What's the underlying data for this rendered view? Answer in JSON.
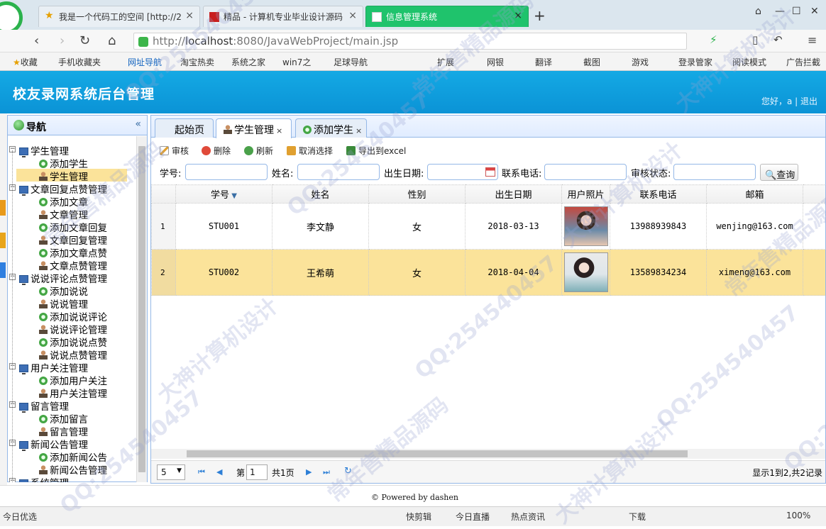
{
  "browser": {
    "tabs": [
      {
        "label": "我是一个代码工的空间 [http://2"
      },
      {
        "label": "精品 - 计算机专业毕业设计源码"
      },
      {
        "label": "信息管理系统"
      }
    ],
    "url_prefix": "http://",
    "url_host": "localhost",
    "url_rest": ":8080/JavaWebProject/main.jsp",
    "bookmarks": [
      "收藏",
      "手机收藏夹",
      "网址导航",
      "淘宝热卖",
      "系统之家",
      "win7之",
      "足球导航",
      "扩展",
      "网银",
      "翻译",
      "截图",
      "游戏",
      "登录管家",
      "阅读模式",
      "广告拦截"
    ],
    "status_left": "今日优选",
    "status_items": [
      "快剪辑",
      "今日直播",
      "热点资讯",
      "下载",
      "100%"
    ]
  },
  "app": {
    "title": "校友录网系统后台管理",
    "welcome": "您好，a  |  退出"
  },
  "nav": {
    "title": "导航",
    "collapse_icon": "«",
    "groups": [
      {
        "label": "学生管理",
        "items": [
          "添加学生",
          "学生管理"
        ]
      },
      {
        "label": "文章回复点赞管理",
        "items": [
          "添加文章",
          "文章管理",
          "添加文章回复",
          "文章回复管理",
          "添加文章点赞",
          "文章点赞管理"
        ]
      },
      {
        "label": "说说评论点赞管理",
        "items": [
          "添加说说",
          "说说管理",
          "添加说说评论",
          "说说评论管理",
          "添加说说点赞",
          "说说点赞管理"
        ]
      },
      {
        "label": "用户关注管理",
        "items": [
          "添加用户关注",
          "用户关注管理"
        ]
      },
      {
        "label": "留言管理",
        "items": [
          "添加留言",
          "留言管理"
        ]
      },
      {
        "label": "新闻公告管理",
        "items": [
          "添加新闻公告",
          "新闻公告管理"
        ]
      },
      {
        "label": "系统管理",
        "items": []
      }
    ]
  },
  "content_tabs": [
    {
      "label": "起始页"
    },
    {
      "label": "学生管理"
    },
    {
      "label": "添加学生"
    }
  ],
  "toolbar": {
    "audit": "审核",
    "delete": "删除",
    "refresh": "刷新",
    "cancel_select": "取消选择",
    "export": "导出到excel"
  },
  "search": {
    "student_no": "学号:",
    "name": "姓名:",
    "birth": "出生日期:",
    "phone": "联系电话:",
    "status": "审核状态:",
    "query": "查询"
  },
  "grid": {
    "columns": [
      "学号",
      "姓名",
      "性别",
      "出生日期",
      "用户照片",
      "联系电话",
      "邮箱"
    ],
    "rows": [
      {
        "num": "1",
        "no": "STU001",
        "name": "李文静",
        "gender": "女",
        "birth": "2018-03-13",
        "phone": "13988939843",
        "email": "wenjing@163.com"
      },
      {
        "num": "2",
        "no": "STU002",
        "name": "王希萌",
        "gender": "女",
        "birth": "2018-04-04",
        "phone": "13589834234",
        "email": "ximeng@163.com"
      }
    ]
  },
  "pager": {
    "page_size": "5",
    "page_label": "第",
    "page_value": "1",
    "total_pages": "共1页",
    "summary": "显示1到2,共2记录"
  },
  "footer": "© Powered by dashen",
  "watermarks": [
    "QQ:254540457",
    "大神计算机设计",
    "常年售精品源码"
  ]
}
